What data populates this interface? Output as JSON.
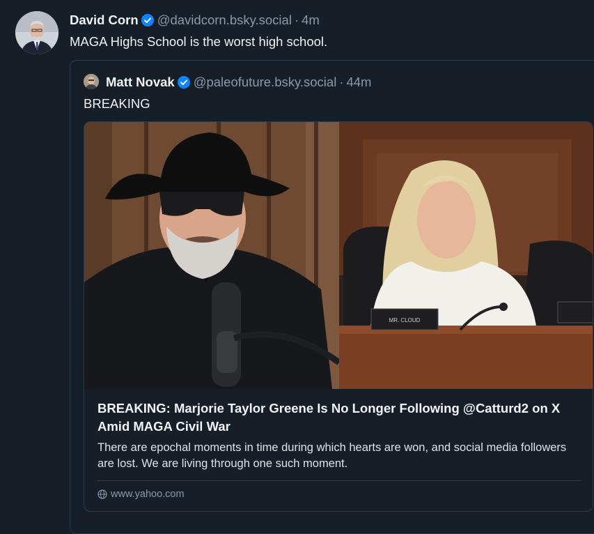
{
  "post": {
    "author_name": "David Corn",
    "handle": "@davidcorn.bsky.social",
    "separator": "·",
    "time": "4m",
    "text": "MAGA Highs School is the worst high school."
  },
  "quote": {
    "author_name": "Matt Novak",
    "handle": "@paleofuture.bsky.social",
    "separator": "·",
    "time": "44m",
    "text": "BREAKING",
    "card": {
      "title": "BREAKING: Marjorie Taylor Greene Is No Longer Following @Catturd2 on X Amid MAGA Civil War",
      "description": "There are epochal moments in time during which hearts are won, and social media followers are lost. We are living through one such moment.",
      "domain": "www.yahoo.com",
      "nameplate_text": "MR. CLOUD"
    }
  },
  "colors": {
    "background": "#161e27",
    "border": "#2e3a49",
    "verified_blue": "#1083fe",
    "muted_text": "#8d98a8"
  },
  "icons": [
    "verified-badge-icon",
    "globe-icon"
  ]
}
